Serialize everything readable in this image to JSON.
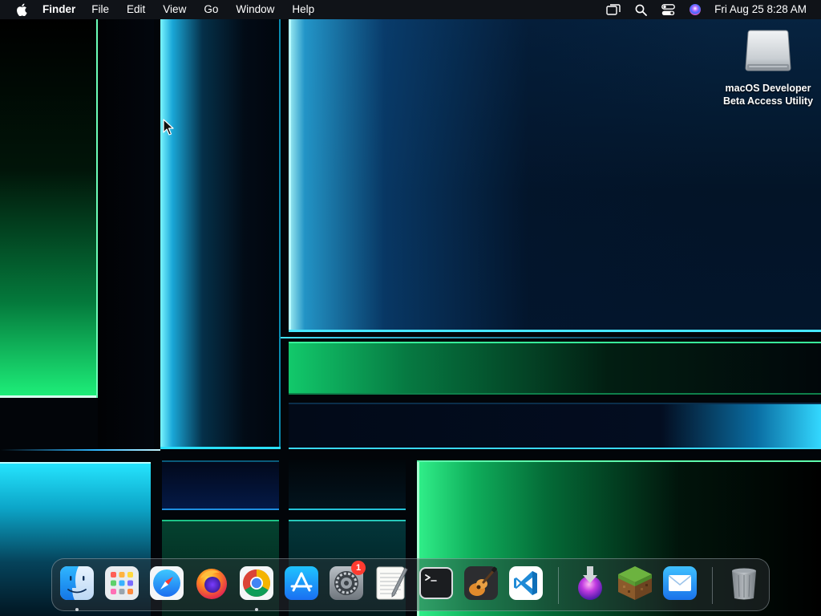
{
  "menubar": {
    "apple_icon": "apple-logo-icon",
    "app_name": "Finder",
    "items": [
      "File",
      "Edit",
      "View",
      "Go",
      "Window",
      "Help"
    ],
    "status_icons": [
      "screen-mirroring-icon",
      "spotlight-search-icon",
      "control-center-icon",
      "siri-icon"
    ],
    "clock": "Fri Aug 25  8:28 AM"
  },
  "desktop": {
    "icons": [
      {
        "label_line1": "macOS Developer",
        "label_line2": "Beta Access Utility",
        "icon": "external-drive-icon"
      }
    ]
  },
  "dock": {
    "items": [
      {
        "app": "Finder",
        "icon": "finder-icon",
        "running": true
      },
      {
        "app": "Launchpad",
        "icon": "launchpad-icon",
        "running": false
      },
      {
        "app": "Safari",
        "icon": "safari-icon",
        "running": false
      },
      {
        "app": "Firefox",
        "icon": "firefox-icon",
        "running": false
      },
      {
        "app": "Google Chrome",
        "icon": "chrome-icon",
        "running": true
      },
      {
        "app": "App Store",
        "icon": "app-store-icon",
        "running": false
      },
      {
        "app": "System Settings",
        "icon": "system-settings-icon",
        "running": false,
        "badge": "1"
      },
      {
        "app": "TextEdit",
        "icon": "textedit-icon",
        "running": false
      },
      {
        "app": "Terminal",
        "icon": "terminal-icon",
        "running": false
      },
      {
        "app": "GarageBand",
        "icon": "garageband-icon",
        "running": false
      },
      {
        "app": "Visual Studio Code",
        "icon": "vscode-icon",
        "running": false
      },
      {
        "app": "Installer",
        "icon": "installer-icon",
        "running": false
      },
      {
        "app": "Minecraft",
        "icon": "minecraft-icon",
        "running": false
      },
      {
        "app": "Mail",
        "icon": "mail-icon",
        "running": false
      },
      {
        "app": "Trash",
        "icon": "trash-icon",
        "running": false
      }
    ]
  },
  "colors": {
    "menubar_bg": "#12161a",
    "badge_red": "#ff3b30",
    "accent_cyan": "#2fd6ff",
    "accent_green": "#1ef07a"
  }
}
